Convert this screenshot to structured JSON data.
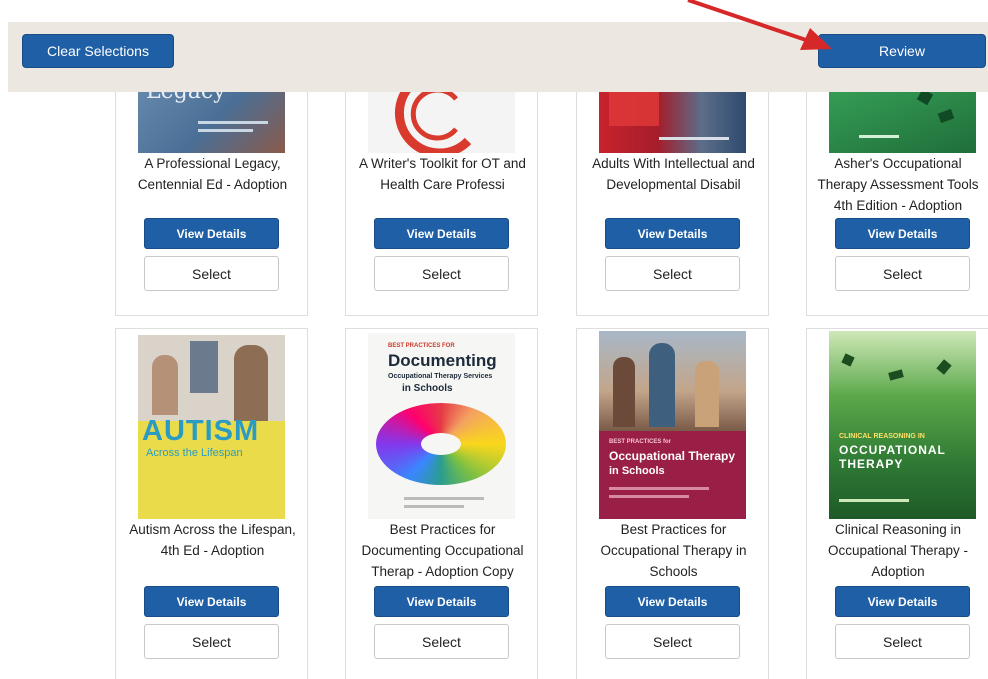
{
  "toolbar": {
    "clear_label": "Clear Selections",
    "review_label": "Review"
  },
  "colors": {
    "primary_button": "#1f5fa6",
    "toolbar_bg": "#ece8e1",
    "annotation_arrow": "#d62828"
  },
  "books": [
    {
      "title_lines": [
        "A Professional Legacy,",
        "Centennial Ed - Adoption"
      ],
      "cover_text": "Legacy",
      "details": "View Details",
      "select": "Select"
    },
    {
      "title_lines": [
        "A Writer's Toolkit for OT and",
        "Health Care Professi"
      ],
      "cover_text": "",
      "details": "View Details",
      "select": "Select"
    },
    {
      "title_lines": [
        "Adults With Intellectual and",
        "Developmental Disabil"
      ],
      "cover_text": "",
      "details": "View Details",
      "select": "Select"
    },
    {
      "title_lines": [
        "Asher's Occupational",
        "Therapy Assessment Tools",
        "4th Edition - Adoption"
      ],
      "cover_text": "",
      "details": "View Details",
      "select": "Select"
    },
    {
      "title_lines": [
        "Autism Across the Lifespan,",
        "4th Ed - Adoption"
      ],
      "cover_text": "AUTISM",
      "cover_sub": "Across the Lifespan",
      "details": "View Details",
      "select": "Select"
    },
    {
      "title_lines": [
        "Best Practices for",
        "Documenting Occupational",
        "Therap - Adoption Copy"
      ],
      "cover_small": "BEST PRACTICES FOR",
      "cover_text": "Documenting",
      "cover_sub": "Occupational Therapy Services",
      "cover_sub2": "in Schools",
      "details": "View Details",
      "select": "Select"
    },
    {
      "title_lines": [
        "Best Practices for",
        "Occupational Therapy in",
        "Schools"
      ],
      "cover_small": "BEST PRACTICES for",
      "cover_text": "Occupational Therapy",
      "cover_sub": "in Schools",
      "details": "View Details",
      "select": "Select"
    },
    {
      "title_lines": [
        "Clinical Reasoning in",
        "Occupational Therapy -",
        "Adoption"
      ],
      "cover_small": "CLINICAL REASONING IN",
      "cover_text": "OCCUPATIONAL",
      "cover_sub": "THERAPY",
      "details": "View Details",
      "select": "Select"
    }
  ]
}
